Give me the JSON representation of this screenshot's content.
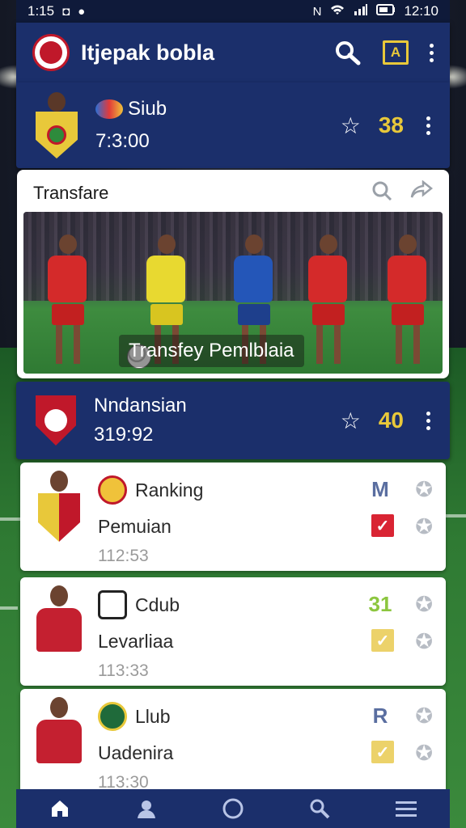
{
  "status_bar": {
    "left_time": "1:15",
    "right_time": "12:10"
  },
  "header": {
    "title": "Itjepak bobla"
  },
  "featured_club_top": {
    "name": "Siub",
    "time": "7:3:00",
    "score": "38"
  },
  "transfer": {
    "title": "Transfare",
    "caption": "Transfey Pemlblaia"
  },
  "featured_club_mid": {
    "name": "Nndansian",
    "time": "319:92",
    "score": "40"
  },
  "list": [
    {
      "club": "Ranking",
      "name": "Pemuian",
      "time": "112:53",
      "mark": "M",
      "mark_color": "#5a6ea0",
      "check_color": "#d92433"
    },
    {
      "club": "Cdub",
      "name": "Levarliaa",
      "time": "113:33",
      "mark": "31",
      "mark_color": "#8cc63f",
      "check_color": "#ecd26a"
    },
    {
      "club": "Llub",
      "name": "Uadenira",
      "time": "113:30",
      "mark": "R",
      "mark_color": "#5a6ea0",
      "check_color": "#ecd26a"
    }
  ],
  "icons": {
    "search": "search-icon",
    "account-box": "a-box-icon",
    "more": "more-vertical-icon",
    "star": "star-icon",
    "share": "share-icon",
    "home": "home-icon",
    "profile": "profile-icon",
    "circle": "circle-icon",
    "pin": "pin-icon",
    "menu": "menu-icon"
  },
  "colors": {
    "header_bg": "#1b2f6b",
    "accent_gold": "#e8c83a"
  }
}
